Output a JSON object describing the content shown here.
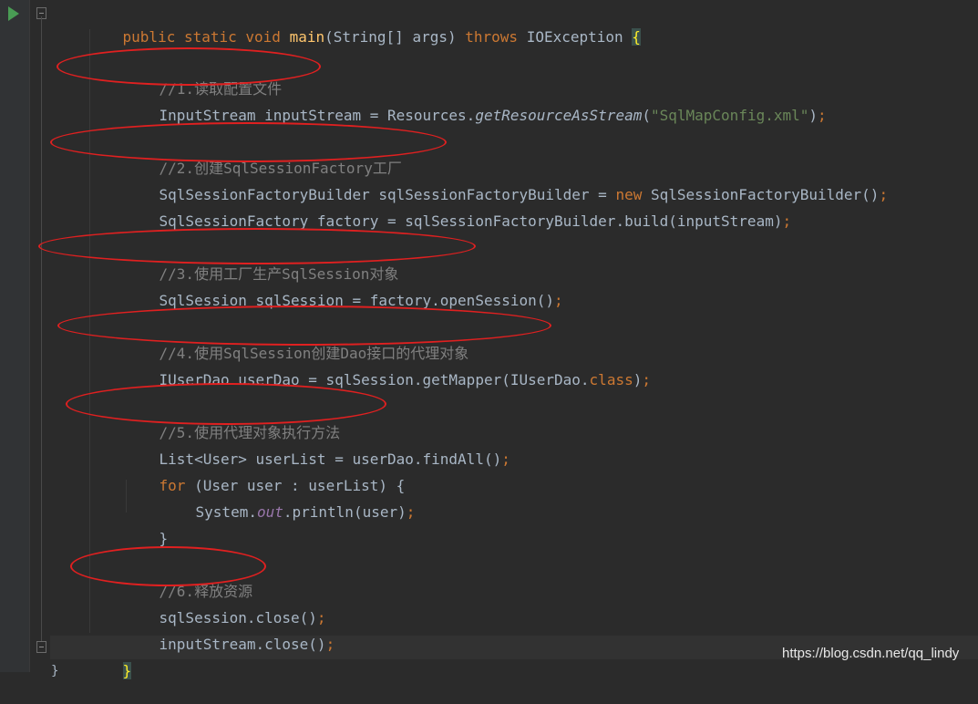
{
  "editor": {
    "colors": {
      "background": "#2b2b2b",
      "keyword": "#cc7832",
      "method": "#ffc66d",
      "string": "#6a8759",
      "comment": "#808080",
      "field": "#9876aa",
      "text": "#a9b7c6",
      "annotation": "#e02020"
    },
    "icons": {
      "run": "run-icon",
      "fold": "fold-marker-icon"
    },
    "signature": {
      "public": "public",
      "static": "static",
      "void": "void",
      "method": "main",
      "params": "(String[] args)",
      "throws": "throws",
      "exception": "IOException",
      "open_brace": "{"
    },
    "comments": [
      "//1.读取配置文件",
      "//2.创建SqlSessionFactory工厂",
      "//3.使用工厂生产SqlSession对象",
      "//4.使用SqlSession创建Dao接口的代理对象",
      "//5.使用代理对象执行方法",
      "//6.释放资源"
    ],
    "line_input_stream": {
      "decl": "InputStream inputStream = Resources.",
      "call": "getResourceAsStream",
      "open": "(",
      "arg": "\"SqlMapConfig.xml\"",
      "close": ")",
      "semi": ";"
    },
    "line_builder": {
      "decl": "SqlSessionFactoryBuilder sqlSessionFactoryBuilder = ",
      "kw_new": "new",
      "ctor": " SqlSessionFactoryBuilder()",
      "semi": ";"
    },
    "line_factory": {
      "text": "SqlSessionFactory factory = sqlSessionFactoryBuilder.build(inputStream)",
      "semi": ";"
    },
    "line_session": {
      "text": "SqlSession sqlSession = factory.openSession()",
      "semi": ";"
    },
    "line_dao": {
      "text": "IUserDao userDao = sqlSession.getMapper(IUserDao.",
      "kw_class": "class",
      "close": ")",
      "semi": ";"
    },
    "line_list": {
      "text": "List<User> userList = userDao.findAll()",
      "semi": ";"
    },
    "line_for": {
      "kw_for": "for",
      "text": " (User user : userList) {"
    },
    "line_print": {
      "sys": "System.",
      "out": "out",
      "call": ".println(user)",
      "semi": ";"
    },
    "line_for_close": "}",
    "line_close_session": {
      "text": "sqlSession.close()",
      "semi": ";"
    },
    "line_close_stream": {
      "text": "inputStream.close()",
      "semi": ";"
    },
    "closing_brace": "}",
    "trailing_brace": "}"
  },
  "watermark": "https://blog.csdn.net/qq_lindy"
}
